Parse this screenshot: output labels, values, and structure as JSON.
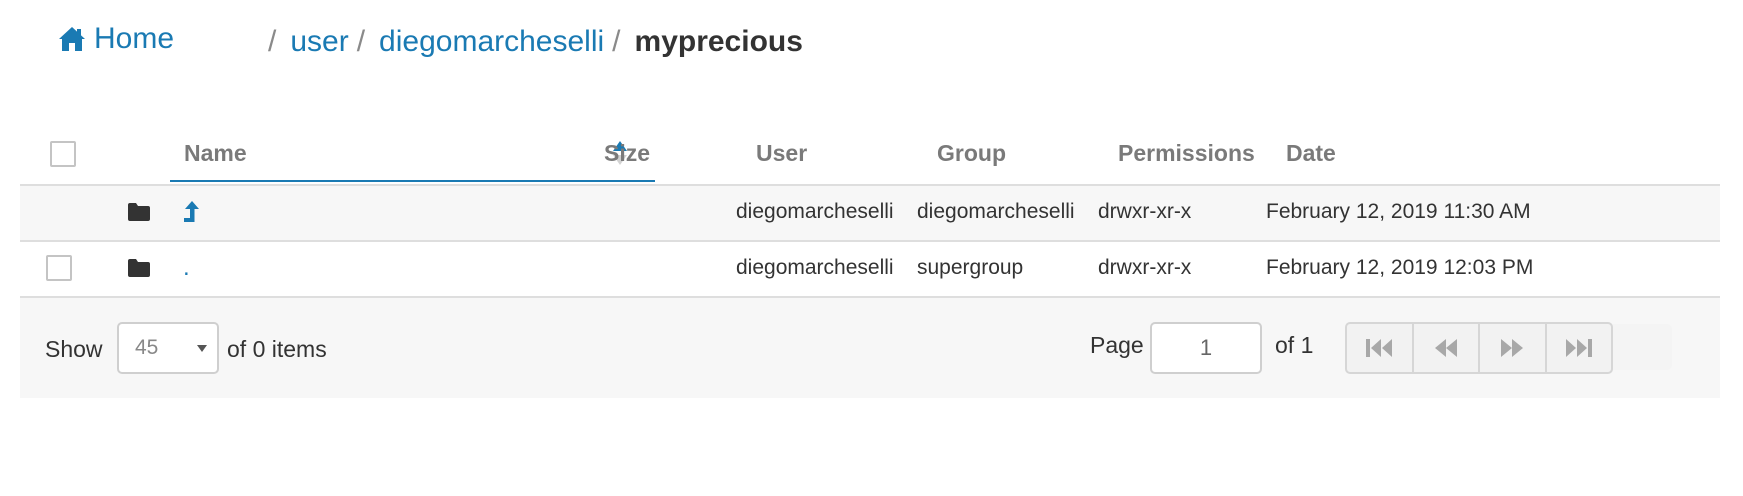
{
  "breadcrumb": {
    "home_label": "Home",
    "separator": "/",
    "segments": [
      "user",
      "diegomarcheselli"
    ],
    "current": "myprecious"
  },
  "table": {
    "columns": [
      "Name",
      "Size",
      "User",
      "Group",
      "Permissions",
      "Date"
    ],
    "sort": {
      "column": "Name",
      "direction": "ascending"
    },
    "rows": [
      {
        "name": "",
        "name_icon": "parent-dir-arrow-icon",
        "size": "",
        "user": "diegomarcheselli",
        "group": "diegomarcheselli",
        "permissions": "drwxr-xr-x",
        "date": "February 12, 2019 11:30 AM"
      },
      {
        "name": ".",
        "size": "",
        "user": "diegomarcheselli",
        "group": "supergroup",
        "permissions": "drwxr-xr-x",
        "date": "February 12, 2019 12:03 PM"
      }
    ]
  },
  "footer": {
    "show_label": "Show",
    "page_size": "45",
    "items_label": "of 0 items",
    "page_label": "Page",
    "current_page": "1",
    "of_pages_label": "of 1"
  },
  "icons": {
    "home": "home-icon",
    "folder": "folder-icon",
    "sort": "sort-icon",
    "pager": [
      "first-page-icon",
      "previous-page-icon",
      "next-page-icon",
      "last-page-icon"
    ]
  },
  "colors": {
    "link": "#1a7ab3",
    "header_text": "#7a7a7a",
    "text": "#333333",
    "row_alt": "#f7f7f7",
    "border": "#dedede"
  }
}
